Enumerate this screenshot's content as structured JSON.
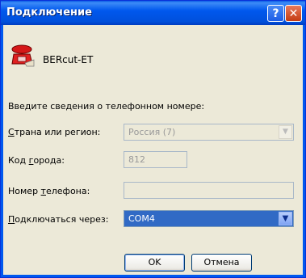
{
  "window": {
    "title": "Подключение"
  },
  "titlebar": {
    "help_glyph": "?",
    "close_glyph": "✕"
  },
  "icon": {
    "name": "phone-icon"
  },
  "connection": {
    "name": "BERcut-ET"
  },
  "form": {
    "prompt": "Введите сведения о телефонном номере:",
    "country": {
      "label_hot": "С",
      "label_rest": "трана или регион:",
      "value": "Россия (7)"
    },
    "area": {
      "label_before": "Код ",
      "label_hot": "г",
      "label_after": "орода:",
      "value": "812"
    },
    "phone": {
      "label_before": "Номер ",
      "label_hot": "т",
      "label_after": "елефона:",
      "value": ""
    },
    "connect_via": {
      "label_hot": "П",
      "label_rest": "одключаться через:",
      "value": "COM4"
    }
  },
  "buttons": {
    "ok": "OK",
    "cancel": "Отмена"
  }
}
